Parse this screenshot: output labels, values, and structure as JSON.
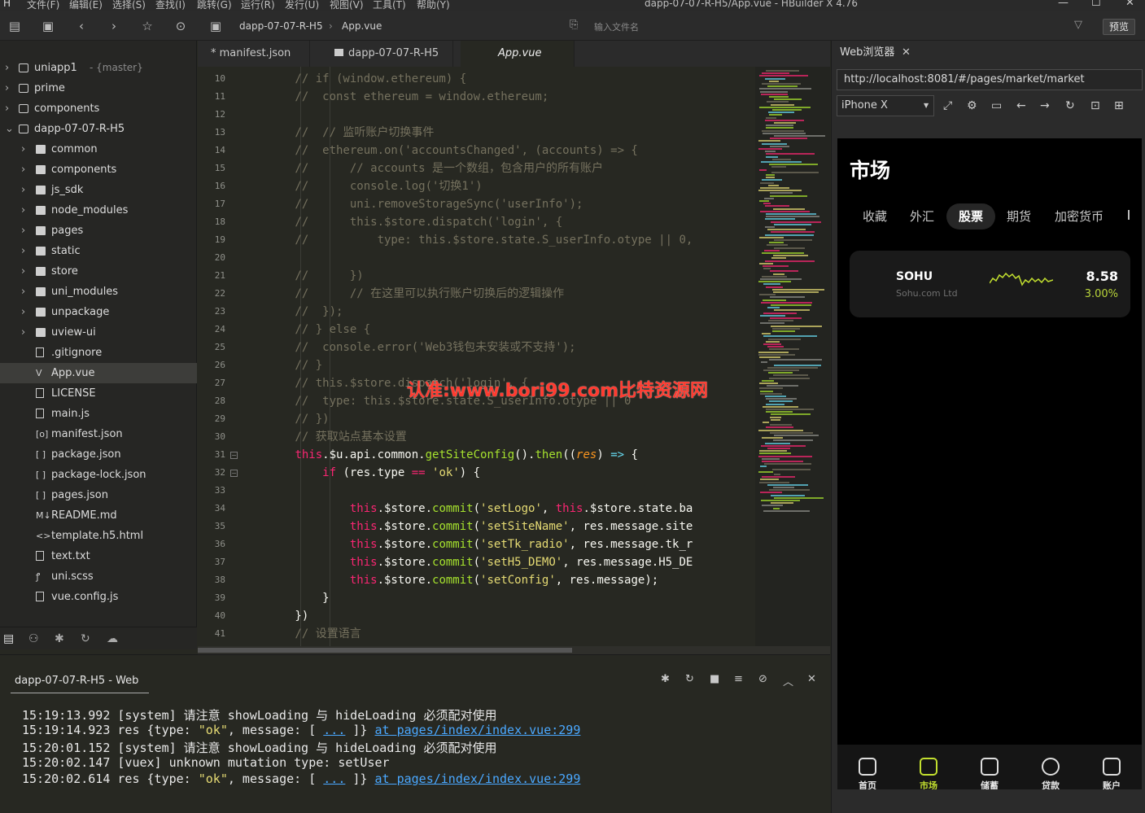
{
  "menubar": {
    "items": [
      "文件(F)",
      "编辑(E)",
      "选择(S)",
      "查找(I)",
      "跳转(G)",
      "运行(R)",
      "发行(U)",
      "视图(V)",
      "工具(T)",
      "帮助(Y)"
    ],
    "window_title": "dapp-07-07-R-H5/App.vue - HBuilder X 4.76"
  },
  "toolbar": {
    "breadcrumb": [
      "dapp-07-07-R-H5",
      "App.vue"
    ],
    "filter_placeholder": "输入文件名",
    "preview_label": "预览"
  },
  "sidebar": {
    "items": [
      {
        "label": "uniapp1",
        "branch": "{master}",
        "kind": "project",
        "depth": 0,
        "open": false
      },
      {
        "label": "prime",
        "kind": "project",
        "depth": 0,
        "open": false
      },
      {
        "label": "components",
        "kind": "project",
        "depth": 0,
        "open": false
      },
      {
        "label": "dapp-07-07-R-H5",
        "kind": "project",
        "depth": 0,
        "open": true
      },
      {
        "label": "common",
        "kind": "folder",
        "depth": 1
      },
      {
        "label": "components",
        "kind": "folder",
        "depth": 1
      },
      {
        "label": "js_sdk",
        "kind": "folder",
        "depth": 1
      },
      {
        "label": "node_modules",
        "kind": "folder",
        "depth": 1
      },
      {
        "label": "pages",
        "kind": "folder",
        "depth": 1
      },
      {
        "label": "static",
        "kind": "folder",
        "depth": 1
      },
      {
        "label": "store",
        "kind": "folder",
        "depth": 1
      },
      {
        "label": "uni_modules",
        "kind": "folder",
        "depth": 1
      },
      {
        "label": "unpackage",
        "kind": "folder",
        "depth": 1
      },
      {
        "label": "uview-ui",
        "kind": "folder",
        "depth": 1
      },
      {
        "label": ".gitignore",
        "kind": "file",
        "depth": 1
      },
      {
        "label": "App.vue",
        "kind": "vue",
        "depth": 1,
        "selected": true
      },
      {
        "label": "LICENSE",
        "kind": "file",
        "depth": 1
      },
      {
        "label": "main.js",
        "kind": "file",
        "depth": 1
      },
      {
        "label": "manifest.json",
        "kind": "manifest",
        "depth": 1
      },
      {
        "label": "package.json",
        "kind": "json",
        "depth": 1
      },
      {
        "label": "package-lock.json",
        "kind": "json",
        "depth": 1
      },
      {
        "label": "pages.json",
        "kind": "json",
        "depth": 1
      },
      {
        "label": "README.md",
        "kind": "md",
        "depth": 1
      },
      {
        "label": "template.h5.html",
        "kind": "html",
        "depth": 1
      },
      {
        "label": "text.txt",
        "kind": "file",
        "depth": 1
      },
      {
        "label": "uni.scss",
        "kind": "scss",
        "depth": 1
      },
      {
        "label": "vue.config.js",
        "kind": "file",
        "depth": 1
      }
    ]
  },
  "tabs": [
    {
      "label": "* manifest.json"
    },
    {
      "label": "dapp-07-07-R-H5"
    },
    {
      "label": "App.vue",
      "active": true
    }
  ],
  "editor": {
    "lines": [
      {
        "n": "10",
        "t": [
          [
            "c-cm",
            "        // if (window.ethereum) {"
          ]
        ]
      },
      {
        "n": "11",
        "t": [
          [
            "c-cm",
            "        //  const ethereum = window.ethereum;"
          ]
        ]
      },
      {
        "n": "12",
        "t": []
      },
      {
        "n": "13",
        "t": [
          [
            "c-cm",
            "        //  // 监听账户切换事件"
          ]
        ]
      },
      {
        "n": "14",
        "t": [
          [
            "c-cm",
            "        //  ethereum.on('accountsChanged', (accounts) => {"
          ]
        ]
      },
      {
        "n": "15",
        "t": [
          [
            "c-cm",
            "        //      // accounts 是一个数组，包含用户的所有账户"
          ]
        ]
      },
      {
        "n": "16",
        "t": [
          [
            "c-cm",
            "        //      console.log('切换1')"
          ]
        ]
      },
      {
        "n": "17",
        "t": [
          [
            "c-cm",
            "        //      uni.removeStorageSync('userInfo');"
          ]
        ]
      },
      {
        "n": "18",
        "t": [
          [
            "c-cm",
            "        //      this.$store.dispatch('login', {"
          ]
        ]
      },
      {
        "n": "19",
        "t": [
          [
            "c-cm",
            "        //          type: this.$store.state.S_userInfo.otype || 0,"
          ]
        ]
      },
      {
        "n": "20",
        "t": []
      },
      {
        "n": "21",
        "t": [
          [
            "c-cm",
            "        //      })"
          ]
        ]
      },
      {
        "n": "22",
        "t": [
          [
            "c-cm",
            "        //      // 在这里可以执行账户切换后的逻辑操作"
          ]
        ]
      },
      {
        "n": "23",
        "t": [
          [
            "c-cm",
            "        //  });"
          ]
        ]
      },
      {
        "n": "24",
        "t": [
          [
            "c-cm",
            "        // } else {"
          ]
        ]
      },
      {
        "n": "25",
        "t": [
          [
            "c-cm",
            "        //  console.error('Web3钱包未安装或不支持');"
          ]
        ]
      },
      {
        "n": "26",
        "t": [
          [
            "c-cm",
            "        // }"
          ]
        ]
      },
      {
        "n": "27",
        "t": [
          [
            "c-cm",
            "        // this.$store.dispatch('login', {"
          ]
        ]
      },
      {
        "n": "28",
        "t": [
          [
            "c-cm",
            "        //  type: this.$store.state.S_userInfo.otype || 0"
          ]
        ]
      },
      {
        "n": "29",
        "t": [
          [
            "c-cm",
            "        // })"
          ]
        ]
      },
      {
        "n": "30",
        "t": [
          [
            "c-cm",
            "        // 获取站点基本设置"
          ]
        ]
      },
      {
        "n": "31",
        "fold": true,
        "t": [
          [
            "c-pl",
            "        "
          ],
          [
            "c-th",
            "this"
          ],
          [
            "c-pl",
            ".$u.api.common."
          ],
          [
            "c-fn",
            "getSiteConfig"
          ],
          [
            "c-pl",
            "()."
          ],
          [
            "c-fn",
            "then"
          ],
          [
            "c-pl",
            "(("
          ],
          [
            "c-pa",
            "res"
          ],
          [
            "c-pl",
            ") "
          ],
          [
            "c-ar",
            "=>"
          ],
          [
            "c-pl",
            " {"
          ]
        ]
      },
      {
        "n": "32",
        "fold": true,
        "t": [
          [
            "c-pl",
            "            "
          ],
          [
            "c-kw",
            "if"
          ],
          [
            "c-pl",
            " (res.type "
          ],
          [
            "c-kw",
            "=="
          ],
          [
            "c-pl",
            " "
          ],
          [
            "c-str",
            "'ok'"
          ],
          [
            "c-pl",
            ") {"
          ]
        ]
      },
      {
        "n": "33",
        "t": []
      },
      {
        "n": "34",
        "t": [
          [
            "c-pl",
            "                "
          ],
          [
            "c-th",
            "this"
          ],
          [
            "c-pl",
            ".$store."
          ],
          [
            "c-fn",
            "commit"
          ],
          [
            "c-pl",
            "("
          ],
          [
            "c-str",
            "'setLogo'"
          ],
          [
            "c-pl",
            ", "
          ],
          [
            "c-th",
            "this"
          ],
          [
            "c-pl",
            ".$store.state.ba"
          ]
        ]
      },
      {
        "n": "35",
        "t": [
          [
            "c-pl",
            "                "
          ],
          [
            "c-th",
            "this"
          ],
          [
            "c-pl",
            ".$store."
          ],
          [
            "c-fn",
            "commit"
          ],
          [
            "c-pl",
            "("
          ],
          [
            "c-str",
            "'setSiteName'"
          ],
          [
            "c-pl",
            ", res.message.site"
          ]
        ]
      },
      {
        "n": "36",
        "t": [
          [
            "c-pl",
            "                "
          ],
          [
            "c-th",
            "this"
          ],
          [
            "c-pl",
            ".$store."
          ],
          [
            "c-fn",
            "commit"
          ],
          [
            "c-pl",
            "("
          ],
          [
            "c-str",
            "'setTk_radio'"
          ],
          [
            "c-pl",
            ", res.message.tk_r"
          ]
        ]
      },
      {
        "n": "37",
        "t": [
          [
            "c-pl",
            "                "
          ],
          [
            "c-th",
            "this"
          ],
          [
            "c-pl",
            ".$store."
          ],
          [
            "c-fn",
            "commit"
          ],
          [
            "c-pl",
            "("
          ],
          [
            "c-str",
            "'setH5_DEMO'"
          ],
          [
            "c-pl",
            ", res.message.H5_DE"
          ]
        ]
      },
      {
        "n": "38",
        "t": [
          [
            "c-pl",
            "                "
          ],
          [
            "c-th",
            "this"
          ],
          [
            "c-pl",
            ".$store."
          ],
          [
            "c-fn",
            "commit"
          ],
          [
            "c-pl",
            "("
          ],
          [
            "c-str",
            "'setConfig'"
          ],
          [
            "c-pl",
            ", res.message);"
          ]
        ]
      },
      {
        "n": "39",
        "t": [
          [
            "c-pl",
            "            }"
          ]
        ]
      },
      {
        "n": "40",
        "t": [
          [
            "c-pl",
            "        })"
          ]
        ]
      },
      {
        "n": "41",
        "t": [
          [
            "c-cm",
            "        // 设置语言"
          ]
        ]
      }
    ]
  },
  "watermark": "认准:www.bori99.com比特资源网",
  "console": {
    "title": "dapp-07-07-R-H5 - Web",
    "lines": [
      {
        "time": "15:19:13.992",
        "text": " [system] 请注意 showLoading 与 hideLoading 必须配对使用"
      },
      {
        "time": "15:19:14.923",
        "pre": " res {type: ",
        "str": "\"ok\"",
        "mid": ", message: [ ",
        "dots": "...",
        "post": " ]} ",
        "link": "at pages/index/index.vue:299"
      },
      {
        "time": "15:20:01.152",
        "text": " [system] 请注意 showLoading 与 hideLoading 必须配对使用"
      },
      {
        "time": "15:20:02.147",
        "text": " [vuex] unknown mutation type: setUser"
      },
      {
        "time": "15:20:02.614",
        "pre": " res {type: ",
        "str": "\"ok\"",
        "mid": ", message: [ ",
        "dots": "...",
        "post": " ]} ",
        "link": "at pages/index/index.vue:299"
      }
    ]
  },
  "browser": {
    "tab_label": "Web浏览器",
    "url": "http://localhost:8081/#/pages/market/market",
    "device": "iPhone X",
    "app": {
      "title": "市场",
      "tabs": [
        "收藏",
        "外汇",
        "股票",
        "期货",
        "加密货币"
      ],
      "active_tab": "股票",
      "stock": {
        "symbol": "SOHU",
        "name": "Sohu.com Ltd",
        "price": "8.58",
        "change": "3.00%"
      },
      "nav": [
        "首页",
        "市场",
        "储蓄",
        "贷款",
        "账户"
      ],
      "active_nav": "市场",
      "accent": "#c2df2f"
    }
  }
}
